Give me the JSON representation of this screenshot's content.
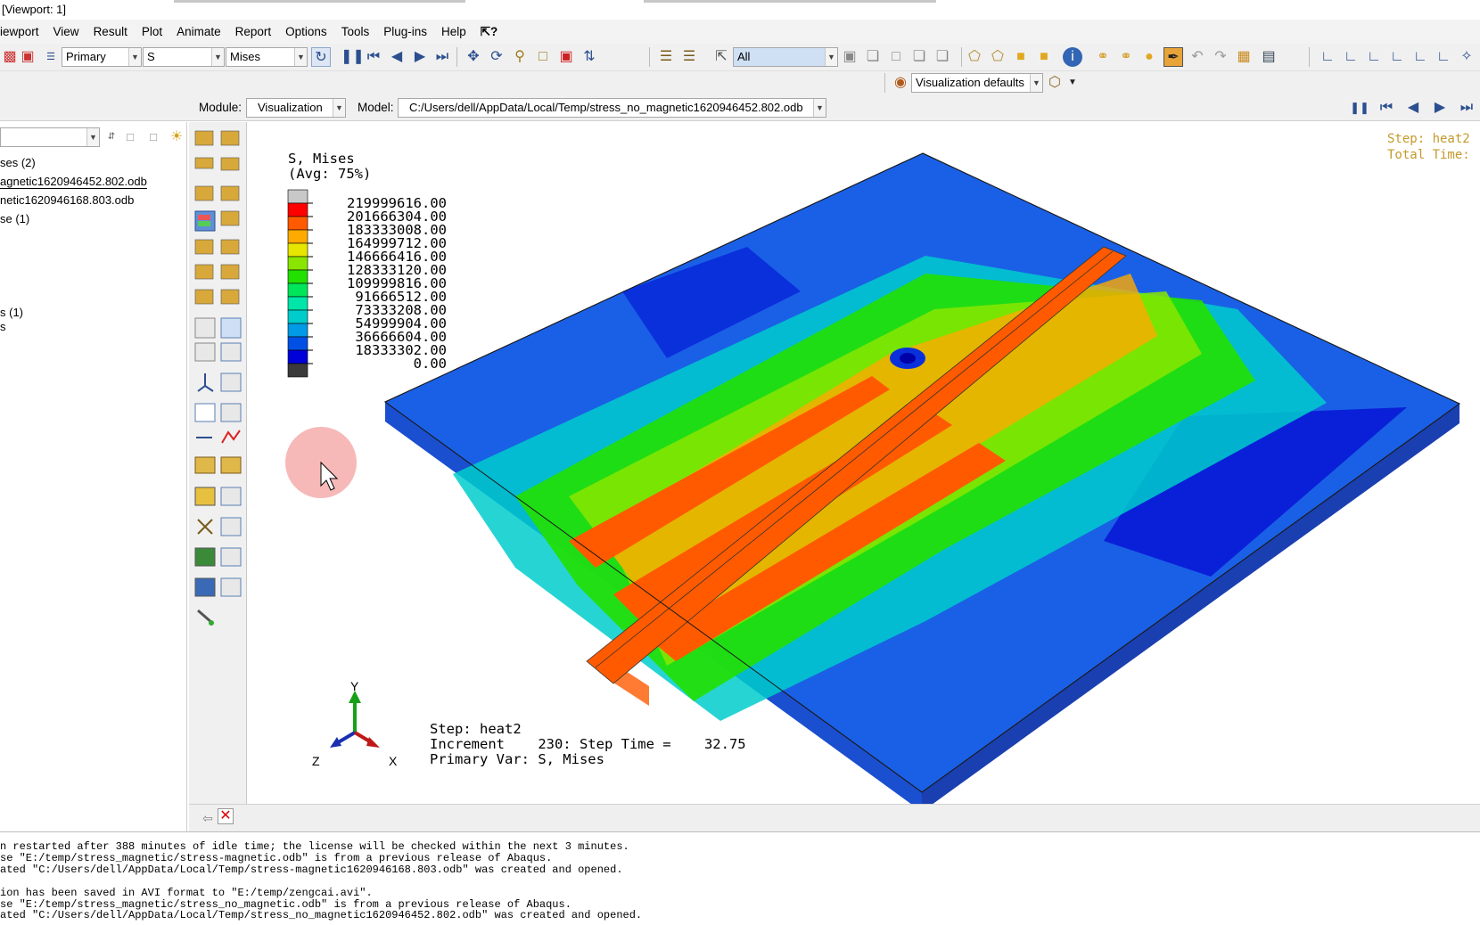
{
  "window": {
    "title": "[Viewport: 1]"
  },
  "menu": [
    "iewport",
    "View",
    "Result",
    "Plot",
    "Animate",
    "Report",
    "Options",
    "Tools",
    "Plug-ins",
    "Help",
    " ?"
  ],
  "toolbar": {
    "field_output_type": "Primary",
    "variable": "S",
    "invariant": "Mises",
    "selection_filter": "All",
    "view_defaults": "Visualization defaults"
  },
  "module_bar": {
    "module_label": "Module:",
    "module_value": "Visualization",
    "model_label": "Model:",
    "model_path": "C:/Users/dell/AppData/Local/Temp/stress_no_magnetic1620946452.802.odb"
  },
  "tree": {
    "items": [
      "ses (2)",
      "agnetic1620946452.802.odb",
      "netic1620946168.803.odb",
      "se (1)",
      "s (1)",
      "s"
    ]
  },
  "legend": {
    "title_line1": "S, Mises",
    "title_line2": "(Avg: 75%)",
    "values": [
      "219999616.00",
      "201666304.00",
      "183333008.00",
      "164999712.00",
      "146666416.00",
      "128333120.00",
      "109999816.00",
      "91666512.00",
      "73333208.00",
      "54999904.00",
      "36666604.00",
      "18333302.00",
      "0.00"
    ],
    "colors": [
      "#c8c8c8",
      "#ff0000",
      "#ff5a00",
      "#ffaa00",
      "#e6e600",
      "#8ae600",
      "#22e000",
      "#00e65a",
      "#00e6aa",
      "#00cccc",
      "#009ae6",
      "#0050e6",
      "#0000d8",
      "#3a3a3a"
    ]
  },
  "state_block": {
    "line1": "Step: heat2",
    "line2": "Increment    230: Step Time =    32.75",
    "line3": "Primary Var: S, Mises"
  },
  "corner_info": {
    "step": "Step: heat2",
    "total_time": "Total Time:"
  },
  "triad": {
    "y": "Y",
    "z": "Z",
    "x": "X"
  },
  "messages": [
    "n restarted after 388 minutes of idle time; the license will be checked within the next 3 minutes.",
    "se \"E:/temp/stress_magnetic/stress-magnetic.odb\" is from a previous release of Abaqus.",
    "ated \"C:/Users/dell/AppData/Local/Temp/stress-magnetic1620946168.803.odb\" was created and opened.",
    "",
    "ion has been saved in AVI format to \"E:/temp/zengcai.avi\".",
    "se \"E:/temp/stress_magnetic/stress_no_magnetic.odb\" is from a previous release of Abaqus.",
    "ated \"C:/Users/dell/AppData/Local/Temp/stress_no_magnetic1620946452.802.odb\" was created and opened."
  ]
}
